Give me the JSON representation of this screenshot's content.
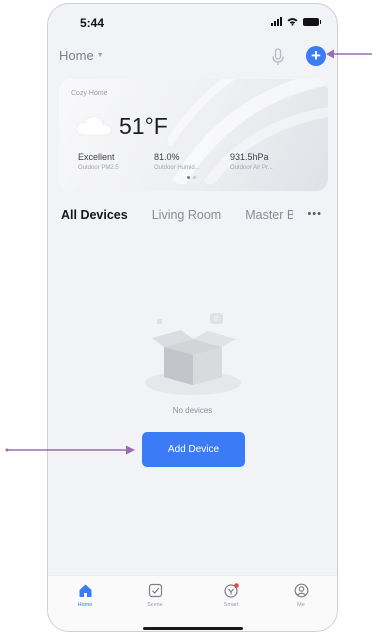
{
  "status_bar": {
    "time": "5:44"
  },
  "header": {
    "home_label": "Home"
  },
  "weather": {
    "location": "Cozy Home",
    "temperature": "51°F",
    "stats": [
      {
        "value": "Excellent",
        "label": "Outdoor PM2.5"
      },
      {
        "value": "81.0%",
        "label": "Outdoor Humid..."
      },
      {
        "value": "931.5hPa",
        "label": "Outdoor Air Pr..."
      }
    ]
  },
  "tabs": [
    {
      "label": "All Devices",
      "active": true
    },
    {
      "label": "Living Room",
      "active": false
    },
    {
      "label": "Master Bedroom",
      "active": false
    }
  ],
  "empty_state": {
    "message": "No devices",
    "button_label": "Add Device"
  },
  "bottom_nav": [
    {
      "label": "Home",
      "icon": "home-icon",
      "active": true
    },
    {
      "label": "Scene",
      "icon": "scene-icon",
      "active": false
    },
    {
      "label": "Smart",
      "icon": "smart-icon",
      "active": false
    },
    {
      "label": "Me",
      "icon": "profile-icon",
      "active": false
    }
  ],
  "colors": {
    "accent": "#3b7cf6",
    "annotation": "#9b6bb0",
    "badge": "#e5483c"
  }
}
